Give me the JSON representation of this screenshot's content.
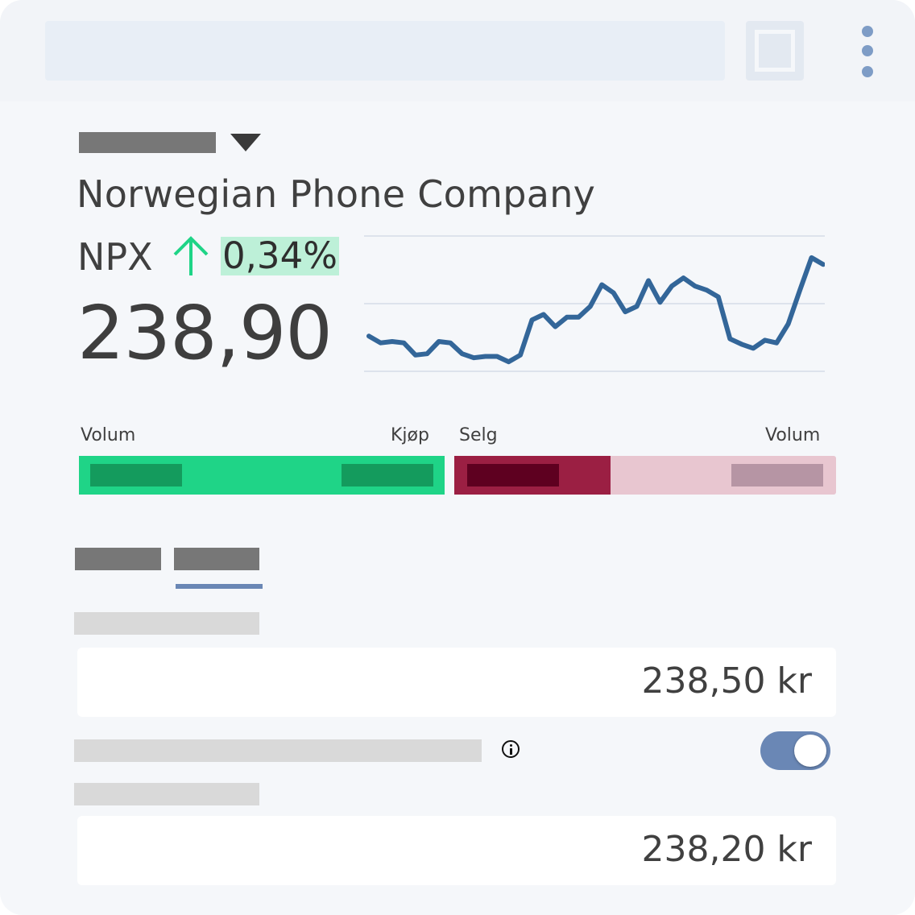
{
  "header": {
    "search_icon": "search-bar-placeholder",
    "square_icon": "square-icon",
    "menu_icon": "kebab-menu-icon"
  },
  "stock": {
    "company_name": "Norwegian Phone Company",
    "ticker": "NPX",
    "change_percent": "0,34%",
    "change_direction": "up",
    "price": "238,90",
    "accent_up_color": "#1fd487",
    "line_color": "#336699"
  },
  "chart_data": {
    "type": "line",
    "title": "",
    "xlabel": "",
    "ylabel": "",
    "grid": true,
    "ylim": [
      0,
      100
    ],
    "series": [
      {
        "values": [
          26,
          21,
          22,
          21,
          12,
          13,
          22,
          21,
          13,
          10,
          11,
          11,
          7,
          12,
          38,
          42,
          33,
          40,
          40,
          48,
          64,
          58,
          44,
          48,
          67,
          51,
          63,
          69,
          63,
          60,
          55,
          24,
          20,
          17,
          23,
          21,
          35,
          60,
          84,
          79
        ]
      }
    ]
  },
  "order_book": {
    "buy_volume_label": "Volum",
    "buy_label": "Kjøp",
    "sell_label": "Selg",
    "sell_volume_label": "Volum",
    "buy_color": "#1fd487",
    "sell_color": "#9b1f43"
  },
  "form": {
    "limit_price": "238,50 kr",
    "stop_price": "238,20 kr",
    "toggle_on": true
  }
}
